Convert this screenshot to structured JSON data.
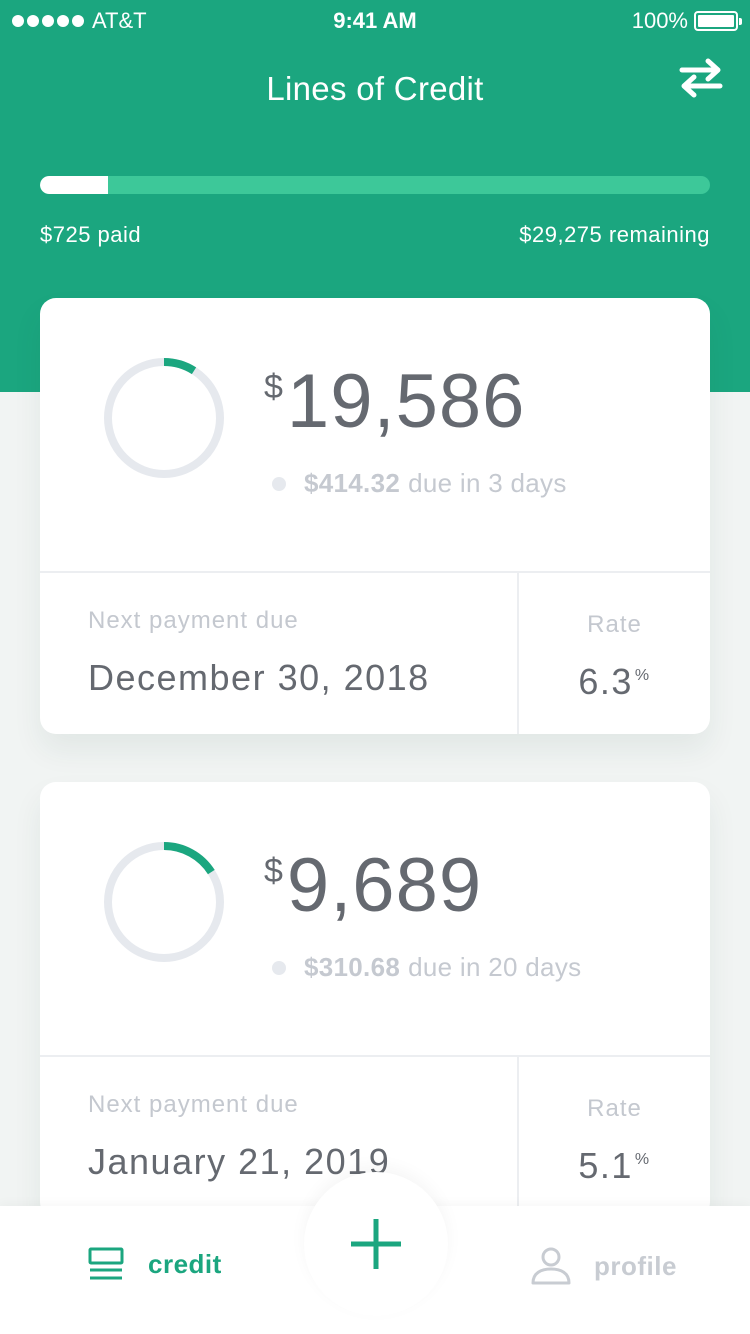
{
  "status_bar": {
    "carrier": "AT&T",
    "time": "9:41 AM",
    "battery": "100%"
  },
  "header": {
    "title": "Lines of Credit",
    "swap_icon": "swap-arrows-icon",
    "progress_fraction": 0.0242,
    "paid_label": "$725 paid",
    "remaining_label": "$29,275 remaining"
  },
  "cards": [
    {
      "currency": "$",
      "amount": "19,586",
      "ring_progress_fraction": 0.09,
      "due_amount": "$414.32",
      "due_text": "due in 3 days",
      "next_payment_label": "Next payment due",
      "next_payment_date": "December 30, 2018",
      "rate_label": "Rate",
      "rate_value": "6.3",
      "rate_unit": "%"
    },
    {
      "currency": "$",
      "amount": "9,689",
      "ring_progress_fraction": 0.16,
      "due_amount": "$310.68",
      "due_text": "due in 20 days",
      "next_payment_label": "Next payment due",
      "next_payment_date": "January 21, 2019",
      "rate_label": "Rate",
      "rate_value": "5.1",
      "rate_unit": "%"
    }
  ],
  "tabbar": {
    "credit_label": "credit",
    "credit_icon": "list-icon",
    "add_icon": "plus-icon",
    "profile_label": "profile",
    "profile_icon": "person-icon"
  },
  "colors": {
    "brand_green": "#1ba67f",
    "progress_track": "#3dc899",
    "text_dark": "#656970",
    "text_muted": "#c4c8cf",
    "ring_track": "#e6e9ee"
  }
}
